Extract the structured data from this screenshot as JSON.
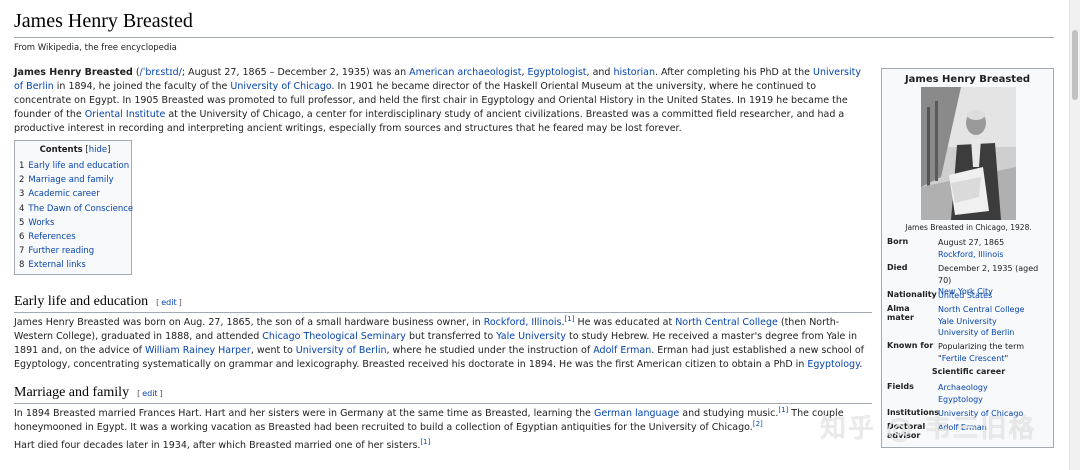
{
  "page": {
    "title": "James Henry Breasted",
    "tagline": "From Wikipedia, the free encyclopedia"
  },
  "intro": {
    "name": "James Henry Breasted",
    "pron_open": " (",
    "pron": "/ˈbrɛstɪd/",
    "t1": "; August 27, 1865 – December 2, 1935) was an ",
    "l1": "American",
    "t2": " ",
    "l2": "archaeologist",
    "t3": ", ",
    "l3": "Egyptologist",
    "t4": ", and ",
    "l4": "historian",
    "t5": ". After completing his PhD at the ",
    "l5": "University of Berlin",
    "t6": " in 1894, he joined the faculty of the ",
    "l6": "University of Chicago",
    "t7": ". In 1901 he became director of the Haskell Oriental Museum at the university, where he continued to concentrate on Egypt. In 1905 Breasted was promoted to full professor, and held the first chair in Egyptology and Oriental History in the United States. In 1919 he became the founder of the ",
    "l7": "Oriental Institute",
    "t8": " at the University of Chicago, a center for interdisciplinary study of ancient civilizations. Breasted was a committed field researcher, and had a productive interest in recording and interpreting ancient writings, especially from sources and structures that he feared may be lost forever."
  },
  "toc": {
    "title": "Contents",
    "hide_open": " [",
    "hide": "hide",
    "hide_close": "]",
    "items": [
      {
        "num": "1",
        "label": "Early life and education"
      },
      {
        "num": "2",
        "label": "Marriage and family"
      },
      {
        "num": "3",
        "label": "Academic career"
      },
      {
        "num": "4",
        "label": "The Dawn of Conscience"
      },
      {
        "num": "5",
        "label": "Works"
      },
      {
        "num": "6",
        "label": "References"
      },
      {
        "num": "7",
        "label": "Further reading"
      },
      {
        "num": "8",
        "label": "External links"
      }
    ]
  },
  "sections": {
    "early": {
      "heading": "Early life and education",
      "edit_open": "[",
      "edit": "edit",
      "edit_close": "]",
      "t1": "James Henry Breasted was born on Aug. 27, 1865, the son of a small hardware business owner, in ",
      "l1": "Rockford, Illinois",
      "t1b": ".",
      "ref1": "[1]",
      "t2": " He was educated at ",
      "l2": "North Central College",
      "t3": " (then North-Western College), graduated in 1888, and attended ",
      "l3": "Chicago Theological Seminary",
      "t4": " but transferred to ",
      "l4": "Yale University",
      "t5": " to study Hebrew. He received a master's degree from Yale in 1891 and, on the advice of ",
      "l5": "William Rainey Harper",
      "t6": ", went to ",
      "l6": "University of Berlin",
      "t7": ", where he studied under the instruction of ",
      "l7": "Adolf Erman",
      "t8": ". Erman had just established a new school of Egyptology, concentrating systematically on grammar and lexicography. Breasted received his doctorate in 1894. He was the first American citizen to obtain a PhD in ",
      "l8": "Egyptology",
      "t9": "."
    },
    "marriage": {
      "heading": "Marriage and family",
      "edit_open": "[",
      "edit": "edit",
      "edit_close": "]",
      "p1_t1": "In 1894 Breasted married Frances Hart. Hart and her sisters were in Germany at the same time as Breasted, learning the ",
      "p1_l1": "German language",
      "p1_t2": " and studying music.",
      "p1_ref1": "[1]",
      "p1_t3": " The couple honeymooned in Egypt. It was a working vacation as Breasted had been recruited to build a collection of Egyptian antiquities for the University of Chicago.",
      "p1_ref2": "[2]",
      "p2_t1": "Hart died four decades later in 1934, after which Breasted married one of her sisters.",
      "p2_ref1": "[1]"
    }
  },
  "infobox": {
    "title": "James Henry Breasted",
    "caption": "James Breasted in Chicago, 1928.",
    "born_label": "Born",
    "born_value": "August 27, 1865",
    "born_place": "Rockford, Illinois",
    "died_label": "Died",
    "died_value": "December 2, 1935 (aged 70)",
    "died_place": "New York City",
    "nationality_label": "Nationality",
    "nationality_value": "United States",
    "alma_label": "Alma mater",
    "alma_values": [
      "North Central College",
      "Yale University",
      "University of Berlin"
    ],
    "known_label": "Known for",
    "known_text": "Popularizing the term \"",
    "known_link": "Fertile Crescent",
    "known_close": "\"",
    "subhead": "Scientific career",
    "fields_label": "Fields",
    "fields_values": [
      "Archaeology",
      "Egyptology"
    ],
    "institutions_label": "Institutions",
    "institutions_value": "University of Chicago",
    "advisor_label": "Doctoral advisor",
    "advisor_value": "Adolf Erman"
  },
  "watermark": "知乎 @ 韦三旧格",
  "colors": {
    "link": "#0645ad",
    "border": "#a2a9b1",
    "infobox_bg": "#f8f9fa"
  }
}
